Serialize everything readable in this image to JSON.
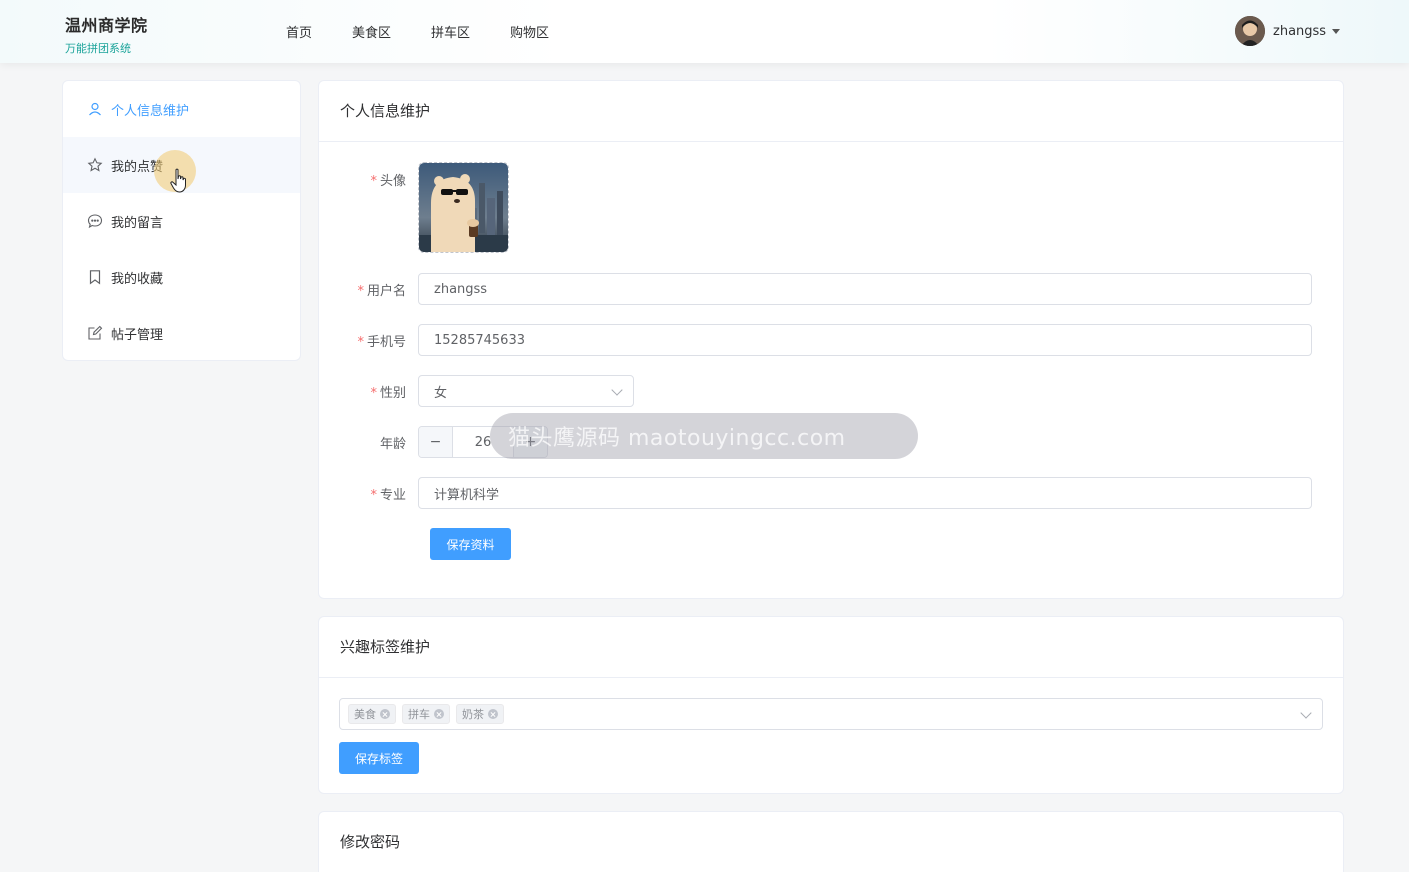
{
  "header": {
    "brand_title": "温州商学院",
    "brand_subtitle": "万能拼团系统",
    "nav": [
      {
        "label": "首页"
      },
      {
        "label": "美食区"
      },
      {
        "label": "拼车区"
      },
      {
        "label": "购物区"
      }
    ],
    "username": "zhangss"
  },
  "sidebar": {
    "items": [
      {
        "label": "个人信息维护",
        "icon": "user-icon",
        "active": true
      },
      {
        "label": "我的点赞",
        "icon": "star-icon"
      },
      {
        "label": "我的留言",
        "icon": "chat-icon"
      },
      {
        "label": "我的收藏",
        "icon": "bookmark-icon"
      },
      {
        "label": "帖子管理",
        "icon": "edit-icon"
      }
    ]
  },
  "profile": {
    "title": "个人信息维护",
    "avatar_label": "头像",
    "username_label": "用户名",
    "username_value": "zhangss",
    "phone_label": "手机号",
    "phone_value": "15285745633",
    "gender_label": "性别",
    "gender_value": "女",
    "age_label": "年龄",
    "age_value": "26",
    "age_minus": "−",
    "age_plus": "+",
    "major_label": "专业",
    "major_value": "计算机科学",
    "save_label": "保存资料",
    "required_mark": "*"
  },
  "tags": {
    "title": "兴趣标签维护",
    "selected": [
      "美食",
      "拼车",
      "奶茶"
    ],
    "save_label": "保存标签"
  },
  "password": {
    "title": "修改密码"
  },
  "watermark": "猫头鹰源码 maotouyingcc.com",
  "colors": {
    "primary": "#409eff",
    "required": "#f56c6c",
    "brand_sub": "#1aa39a"
  }
}
